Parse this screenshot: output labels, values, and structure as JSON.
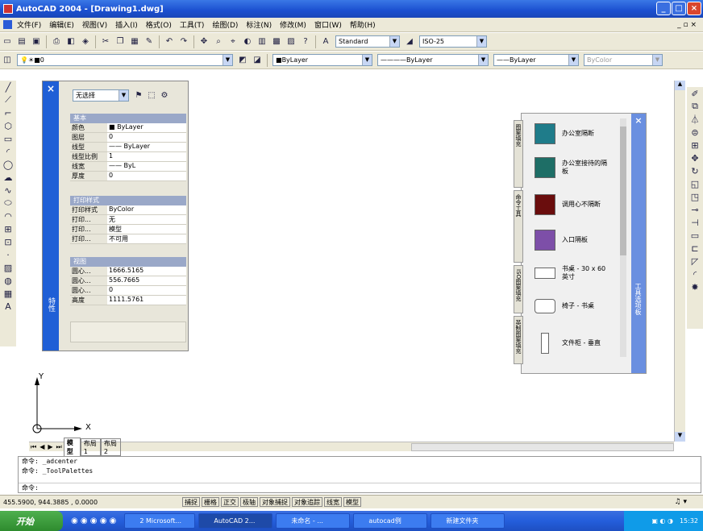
{
  "window": {
    "title": "AutoCAD 2004 - [Drawing1.dwg]"
  },
  "menu": [
    "文件(F)",
    "编辑(E)",
    "视图(V)",
    "插入(I)",
    "格式(O)",
    "工具(T)",
    "绘图(D)",
    "标注(N)",
    "修改(M)",
    "窗口(W)",
    "帮助(H)"
  ],
  "toolbar2": {
    "text_style": "Standard",
    "dim_style": "ISO-25"
  },
  "toolbar3": {
    "layer": "0",
    "color": "ByLayer",
    "linetype": "ByLayer",
    "lineweight": "ByLayer",
    "plotstyle": "ByColor"
  },
  "properties": {
    "selection": "无选择",
    "title": "特性",
    "sections": [
      {
        "header": "基本",
        "rows": [
          {
            "k": "颜色",
            "v": "■ ByLayer"
          },
          {
            "k": "图层",
            "v": "0"
          },
          {
            "k": "线型",
            "v": "—— ByLayer"
          },
          {
            "k": "线型比例",
            "v": "1"
          },
          {
            "k": "线宽",
            "v": "—— ByL"
          },
          {
            "k": "厚度",
            "v": "0"
          }
        ]
      },
      {
        "header": "打印样式",
        "rows": [
          {
            "k": "打印样式",
            "v": "ByColor"
          },
          {
            "k": "打印...",
            "v": "无"
          },
          {
            "k": "打印...",
            "v": "模型"
          },
          {
            "k": "打印...",
            "v": "不可用"
          }
        ]
      },
      {
        "header": "视图",
        "rows": [
          {
            "k": "圆心...",
            "v": "1666.5165"
          },
          {
            "k": "圆心...",
            "v": "556.7665"
          },
          {
            "k": "圆心...",
            "v": "0"
          },
          {
            "k": "高度",
            "v": "1111.5761"
          }
        ]
      }
    ]
  },
  "tool_palette": {
    "title": "工具选项板",
    "tabs": [
      "图案填充",
      "命令工具",
      "ISO图案填充",
      "英制图案填充"
    ],
    "items": [
      {
        "label": "办公室隔断",
        "color": "#1f7c8a"
      },
      {
        "label": "办公室接待的隔板",
        "color": "#1e6e66"
      },
      {
        "label": "调用心不隔断",
        "color": "#6a0d0d"
      },
      {
        "label": "入口隔板",
        "color": "#7d4fa8"
      },
      {
        "label": "书桌 - 30 x 60 英寸",
        "color": ""
      },
      {
        "label": "椅子 - 书桌",
        "color": ""
      },
      {
        "label": "文件柜 - 垂直",
        "color": ""
      }
    ]
  },
  "axis": {
    "x": "X",
    "y": "Y"
  },
  "layout_tabs": [
    "模型",
    "布局1",
    "布局2"
  ],
  "command_lines": [
    "命令: _adcenter",
    "命令: _ToolPalettes",
    "命令:"
  ],
  "status": {
    "coords": "455.5900, 944.3885 , 0.0000",
    "buttons": [
      "捕捉",
      "栅格",
      "正交",
      "极轴",
      "对象捕捉",
      "对象追踪",
      "线宽",
      "模型"
    ]
  },
  "taskbar": {
    "start": "开始",
    "tasks": [
      "2 Microsoft...",
      "AutoCAD 2...",
      "未命名 - ...",
      "autocad例",
      "新建文件夹"
    ],
    "clock": "15:32"
  }
}
